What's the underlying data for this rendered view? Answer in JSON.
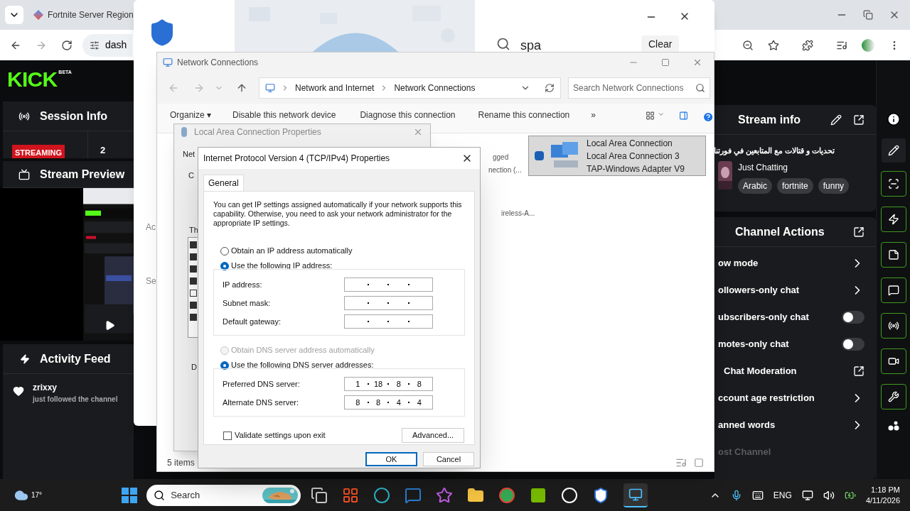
{
  "browser": {
    "tab_title": "Fortnite Server Region",
    "address": "dash"
  },
  "kick": {
    "logo": "KICK",
    "badge": "BETA",
    "session_info": {
      "title": "Session Info",
      "status": "STREAMING",
      "count": "2"
    },
    "stream_preview": {
      "title": "Stream Preview"
    },
    "activity_feed": {
      "title": "Activity Feed",
      "events": [
        {
          "user": "zrixxy",
          "action": "just followed the channel"
        }
      ]
    },
    "stream_info": {
      "title": "Stream info",
      "stream_title": "تحديات و قتالات مع المتابعين في فورتنا",
      "category": "Just Chatting",
      "tags": [
        "Arabic",
        "fortnite",
        "funny"
      ]
    },
    "channel_actions": {
      "title": "Channel Actions",
      "items": [
        {
          "label": "ow mode",
          "kind": "chevron"
        },
        {
          "label": "ollowers-only chat",
          "kind": "chevron"
        },
        {
          "label": "ubscribers-only chat",
          "kind": "toggle",
          "on": false
        },
        {
          "label": "motes-only chat",
          "kind": "toggle",
          "on": false
        },
        {
          "label": "Chat Moderation",
          "kind": "external"
        },
        {
          "label": "ccount age restriction",
          "kind": "chevron"
        },
        {
          "label": "anned words",
          "kind": "chevron"
        },
        {
          "label": "ost Channel",
          "kind": "faded"
        }
      ]
    }
  },
  "popup": {
    "search": "spa",
    "clear": "Clear",
    "side_texts": [
      "Ac",
      "Se"
    ]
  },
  "network": {
    "title": "Network Connections",
    "breadcrumb": [
      "Network and Internet",
      "Network Connections"
    ],
    "search_placeholder": "Search Network Connections",
    "commands": [
      "Organize ▾",
      "Disable this network device",
      "Diagnose this connection",
      "Rename this connection",
      "»"
    ],
    "partial_texts": [
      "gged",
      "nection (...",
      "ireless-A..."
    ],
    "connection": {
      "name": "Local Area Connection",
      "status": "Local Area Connection 3",
      "device": "TAP-Windows Adapter V9",
      "selected": true
    },
    "status": "5 items"
  },
  "lac": {
    "title": "Local Area Connection Properties",
    "tab": "Net",
    "texts": [
      "C",
      "Th",
      "D"
    ],
    "components": [
      {
        "checked": true
      },
      {
        "checked": true
      },
      {
        "checked": true
      },
      {
        "checked": true
      },
      {
        "checked": false
      },
      {
        "checked": true
      },
      {
        "checked": true
      }
    ]
  },
  "ipv4": {
    "title": "Internet Protocol Version 4 (TCP/IPv4) Properties",
    "tab": "General",
    "description": "You can get IP settings assigned automatically if your network supports this capability. Otherwise, you need to ask your network administrator for the appropriate IP settings.",
    "ip_mode": [
      {
        "label": "Obtain an IP address automatically",
        "selected": false
      },
      {
        "label": "Use the following IP address:",
        "selected": true
      }
    ],
    "ip_fields": [
      {
        "label": "IP address:"
      },
      {
        "label": "Subnet mask:"
      },
      {
        "label": "Default gateway:"
      }
    ],
    "dns_mode": [
      {
        "label": "Obtain DNS server address automatically",
        "selected": false,
        "disabled": true
      },
      {
        "label": "Use the following DNS server addresses:",
        "selected": true,
        "disabled": false
      }
    ],
    "dns_fields": [
      {
        "label": "Preferred DNS server:",
        "octets": [
          "1",
          "18",
          "8",
          "8"
        ]
      },
      {
        "label": "Alternate DNS server:",
        "octets": [
          "8",
          "8",
          "4",
          "4"
        ]
      }
    ],
    "validate": {
      "label": "Validate settings upon exit",
      "checked": false
    },
    "advanced": "Advanced...",
    "ok": "OK",
    "cancel": "Cancel"
  },
  "taskbar": {
    "weather": "17°",
    "search": "Search",
    "language": "ENG",
    "time": "1:18 PM",
    "date": "4/11/2026"
  }
}
